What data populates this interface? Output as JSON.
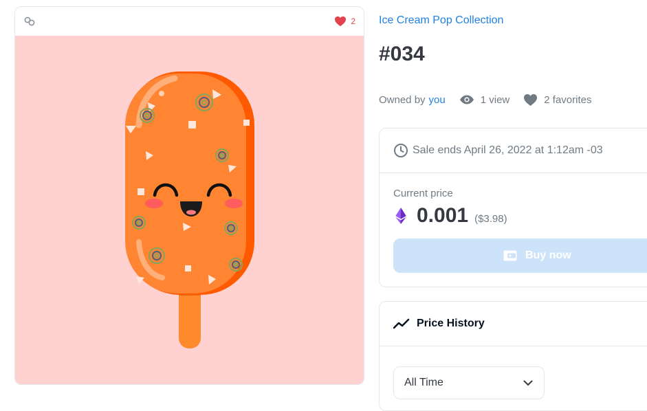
{
  "card": {
    "chain_icon": "link-chain-icon",
    "favorite_icon": "heart-icon",
    "favorite_count": "2",
    "image_subject": "orange-popsicle-illustration",
    "colors": {
      "background": "#ffd1d1",
      "popsicle": "#ff8533",
      "stick": "#ff8a2b",
      "heart": "#e2434e"
    }
  },
  "item": {
    "collection_name": "Ice Cream Pop Collection",
    "title": "#034"
  },
  "meta": {
    "owned_by_label": "Owned by",
    "owner": "you",
    "views_icon": "eye-icon",
    "views": "1 view",
    "favorites_icon": "heart-icon",
    "favorites": "2 favorites"
  },
  "sale": {
    "clock_icon": "clock-icon",
    "ends_text": "Sale ends April 26, 2022 at 1:12am -03",
    "current_price_label": "Current price",
    "currency_icon": "ethereum-icon",
    "price": "0.001",
    "price_usd": "($3.98)",
    "buy_button_label": "Buy now",
    "buy_button_icon": "wallet-icon",
    "colors": {
      "button_bg": "#cce3f9",
      "accent": "#2081e2"
    }
  },
  "history": {
    "icon": "trending-line-icon",
    "title": "Price History",
    "range_selected": "All Time"
  }
}
